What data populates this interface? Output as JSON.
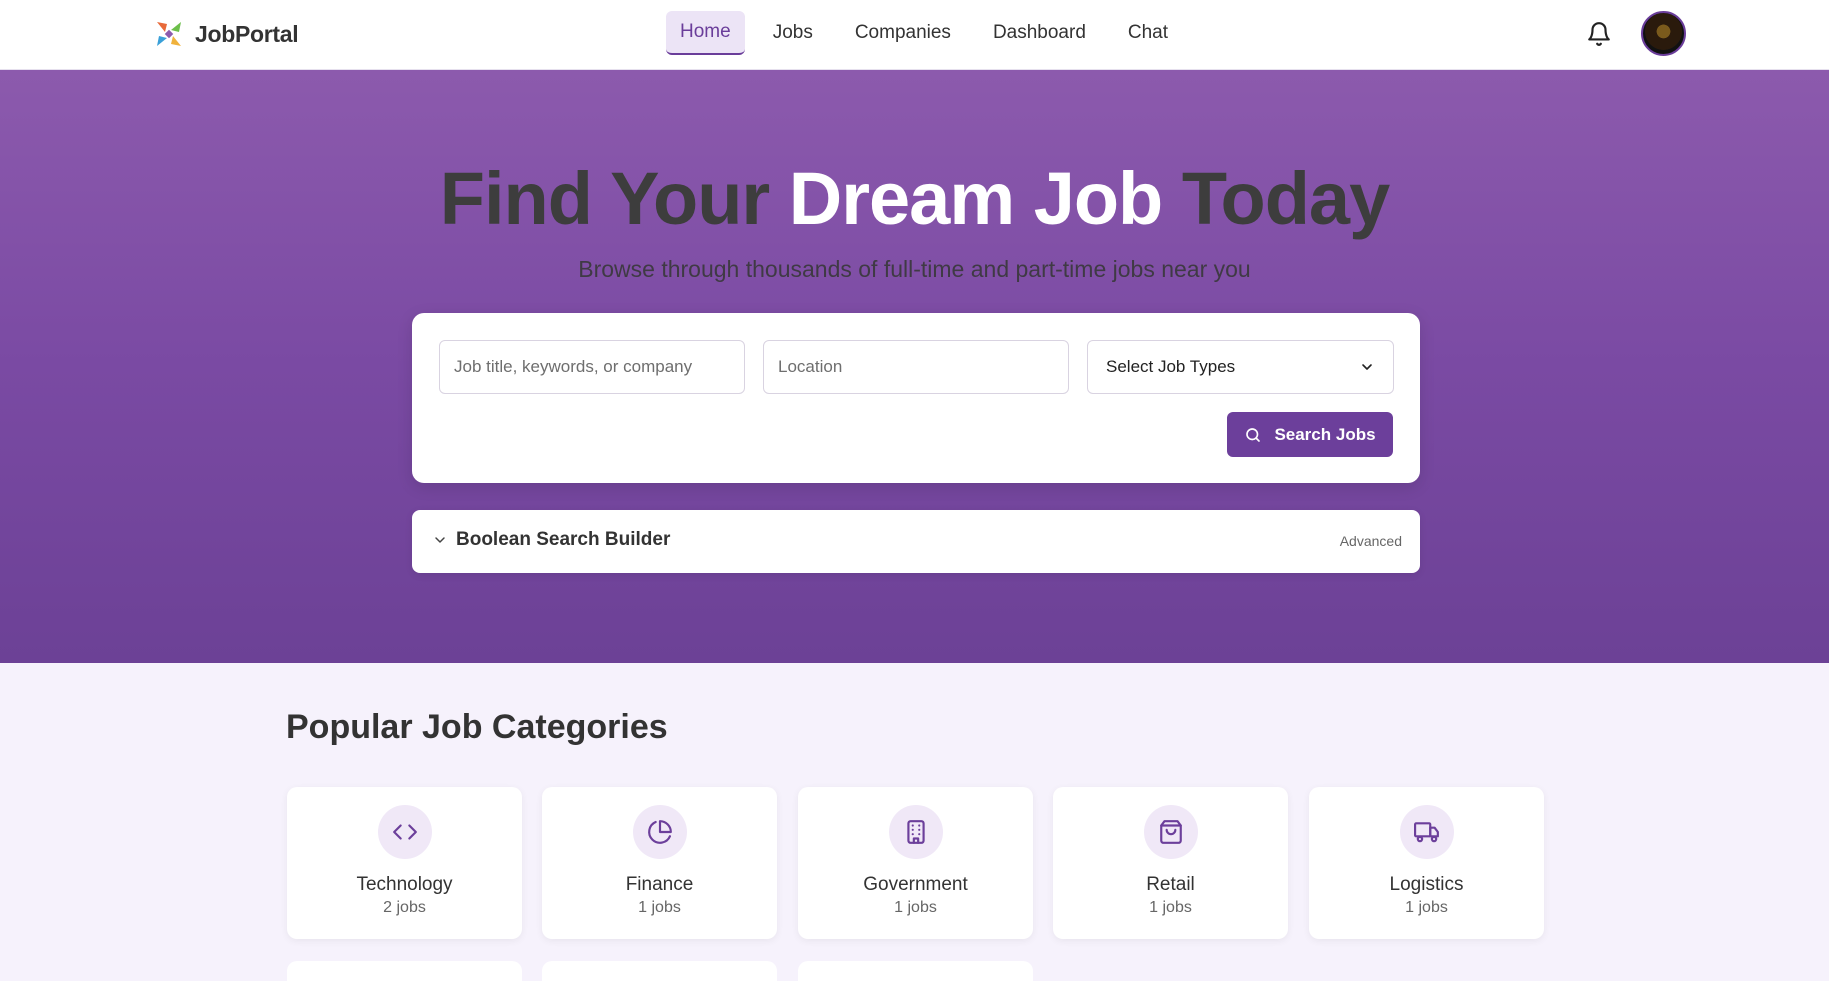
{
  "navbar": {
    "brand": "JobPortal",
    "links": [
      {
        "label": "Home",
        "active": true
      },
      {
        "label": "Jobs",
        "active": false
      },
      {
        "label": "Companies",
        "active": false
      },
      {
        "label": "Dashboard",
        "active": false
      },
      {
        "label": "Chat",
        "active": false
      }
    ],
    "icons": [
      "bell-icon",
      "avatar"
    ]
  },
  "hero": {
    "title_part1": "Find Your",
    "title_part2": "Dream Job",
    "title_part3": "Today",
    "subtitle": "Browse through thousands of full-time and part-time jobs near you"
  },
  "search": {
    "keyword_placeholder": "Job title, keywords, or company",
    "location_placeholder": "Location",
    "job_type_selected": "Select Job Types",
    "button_label": "Search Jobs"
  },
  "boolean_builder": {
    "label": "Boolean Search Builder",
    "badge": "Advanced"
  },
  "categories": {
    "title": "Popular Job Categories",
    "items": [
      {
        "name": "Technology",
        "count": "2 jobs",
        "icon": "code-icon"
      },
      {
        "name": "Finance",
        "count": "1 jobs",
        "icon": "pie-chart-icon"
      },
      {
        "name": "Government",
        "count": "1 jobs",
        "icon": "building-icon"
      },
      {
        "name": "Retail",
        "count": "1 jobs",
        "icon": "shopping-bag-icon"
      },
      {
        "name": "Logistics",
        "count": "1 jobs",
        "icon": "truck-icon"
      }
    ]
  },
  "colors": {
    "accent": "#6c3f9b",
    "hero_top": "#8c5aad",
    "hero_bottom": "#6c4196",
    "page_bg": "#f6f2fc"
  }
}
